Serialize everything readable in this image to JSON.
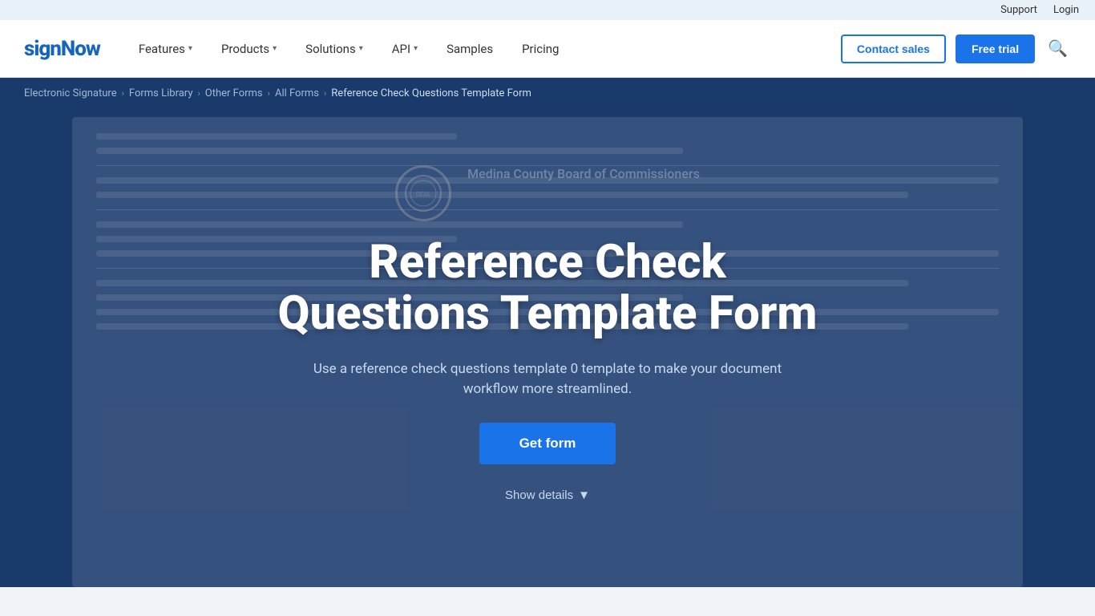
{
  "topbar": {
    "support_label": "Support",
    "login_label": "Login"
  },
  "nav": {
    "logo_sign": "sign",
    "logo_now": "Now",
    "logo_full": "signNow",
    "items": [
      {
        "id": "features",
        "label": "Features",
        "has_dropdown": true
      },
      {
        "id": "products",
        "label": "Products",
        "has_dropdown": true
      },
      {
        "id": "solutions",
        "label": "Solutions",
        "has_dropdown": true
      },
      {
        "id": "api",
        "label": "API",
        "has_dropdown": true
      },
      {
        "id": "samples",
        "label": "Samples",
        "has_dropdown": false
      },
      {
        "id": "pricing",
        "label": "Pricing",
        "has_dropdown": false
      }
    ],
    "contact_sales": "Contact sales",
    "free_trial": "Free trial"
  },
  "breadcrumb": {
    "items": [
      {
        "id": "electronic-signature",
        "label": "Electronic Signature"
      },
      {
        "id": "forms-library",
        "label": "Forms Library"
      },
      {
        "id": "other-forms",
        "label": "Other Forms"
      },
      {
        "id": "all-forms",
        "label": "All Forms"
      }
    ],
    "current": "Reference Check Questions Template Form"
  },
  "hero": {
    "org_name": "Medina County Board of Commissioners",
    "title_line1": "Reference Check",
    "title_line2": "Questions Template Form",
    "subtitle": "Use a reference check questions template 0 template to make your document workflow more streamlined.",
    "get_form_label": "Get form",
    "show_details_label": "Show details"
  }
}
